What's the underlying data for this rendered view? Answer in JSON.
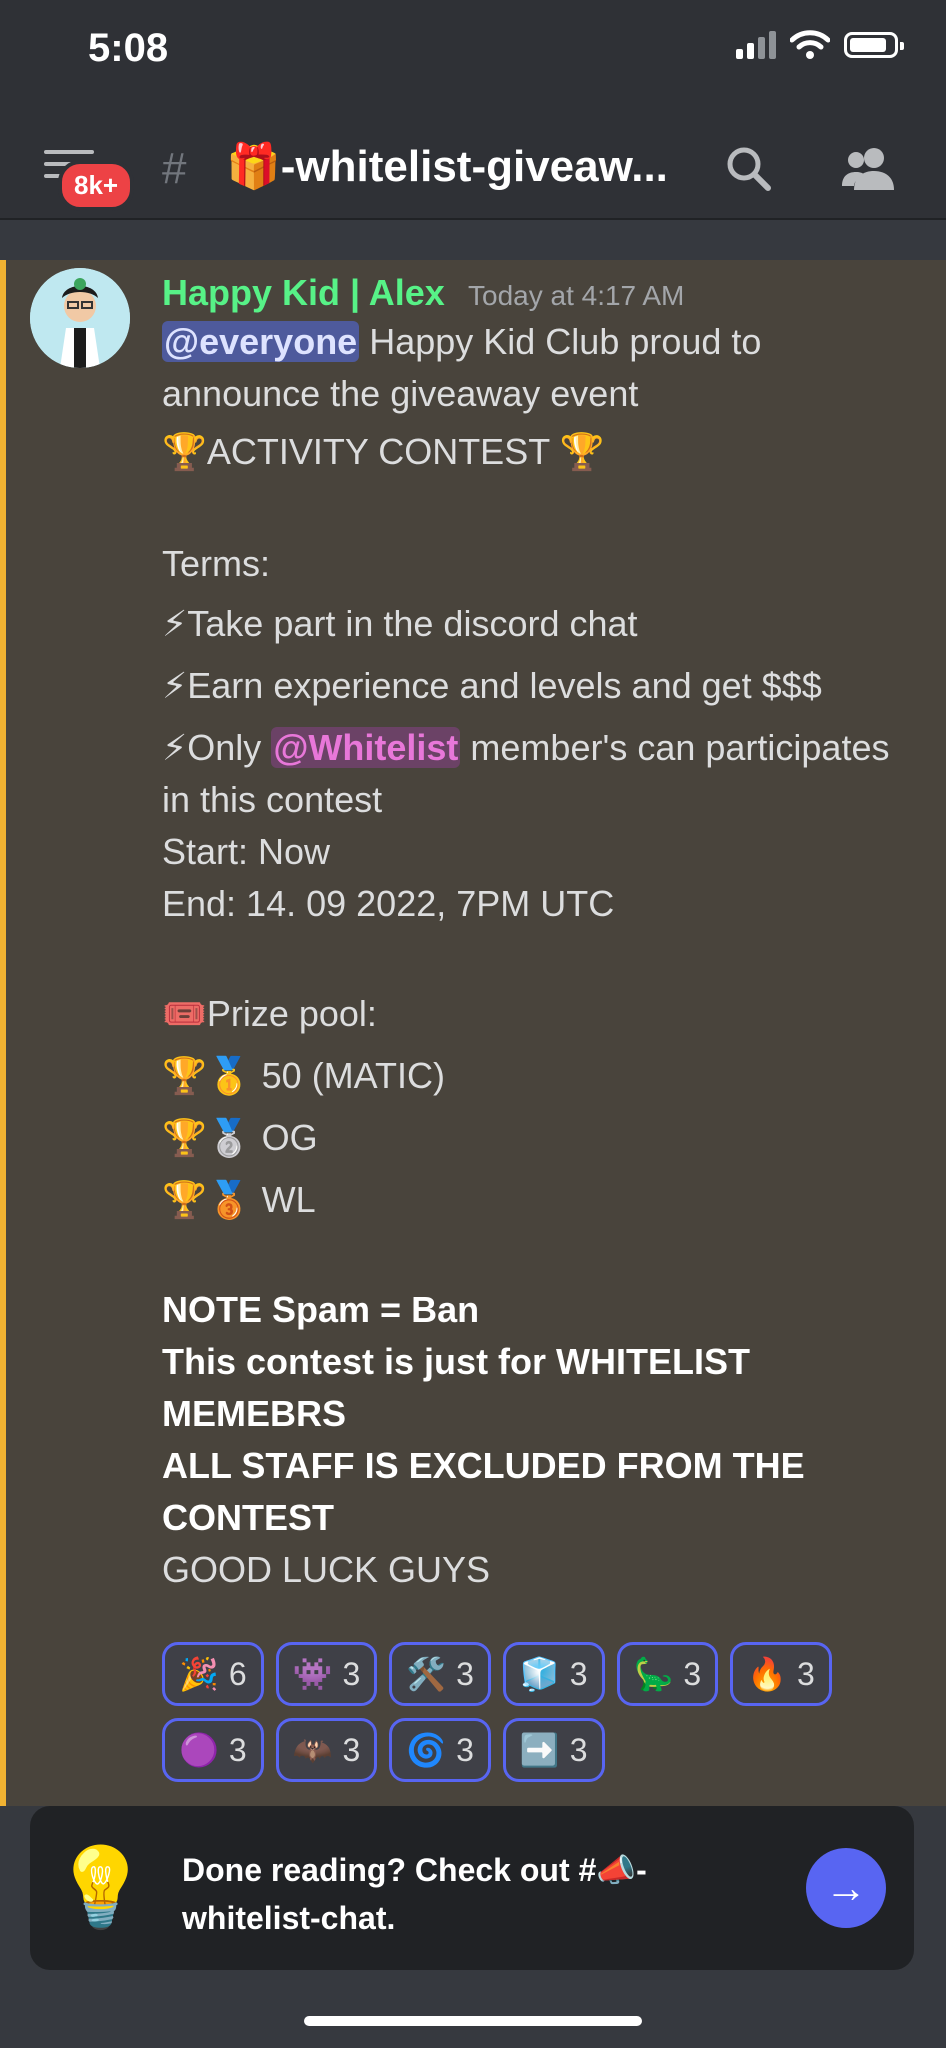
{
  "status_bar": {
    "time": "5:08"
  },
  "header": {
    "unread_badge": "8k+",
    "channel_glyph": "#",
    "channel_name": "🎁-whitelist-giveaw..."
  },
  "message": {
    "author": "Happy Kid | Alex",
    "timestamp": "Today at 4:17 AM",
    "mention": "@everyone",
    "line1_rest": " Happy Kid Club proud to announce the giveaway event",
    "contest_title": "🏆ACTIVITY CONTEST 🏆",
    "terms_label": "Terms:",
    "term1": "⚡Take part in the discord chat",
    "term2": "⚡Earn experience and levels and get $$$",
    "term3_prefix": "⚡Only ",
    "term3_role": "@Whitelist",
    "term3_rest": " member's can participates in this contest",
    "start": "Start: Now",
    "end": "End: 14. 09 2022, 7PM UTC",
    "prize_label": "🎟️Prize pool:",
    "prize1": "🏆🥇 50 (MATIC)",
    "prize2": "🏆🥈 OG",
    "prize3": "🏆🥉 WL",
    "note1": "NOTE Spam = Ban",
    "note2": "This contest is just for WHITELIST MEMEBRS",
    "note3": "ALL STAFF IS EXCLUDED FROM THE CONTEST",
    "good_luck": "GOOD LUCK GUYS"
  },
  "reactions": [
    {
      "emoji": "🎉",
      "count": "6"
    },
    {
      "emoji": "👾",
      "count": "3"
    },
    {
      "emoji": "🛠️",
      "count": "3"
    },
    {
      "emoji": "🧊",
      "count": "3"
    },
    {
      "emoji": "🦕",
      "count": "3"
    },
    {
      "emoji": "🔥",
      "count": "3"
    },
    {
      "emoji": "🟣",
      "count": "3"
    },
    {
      "emoji": "🦇",
      "count": "3"
    },
    {
      "emoji": "🌀",
      "count": "3"
    },
    {
      "emoji": "➡️",
      "count": "3"
    }
  ],
  "prompt": {
    "icon": "💡",
    "text": "Done reading? Check out #📣-whitelist-chat.",
    "button_icon": "→"
  }
}
